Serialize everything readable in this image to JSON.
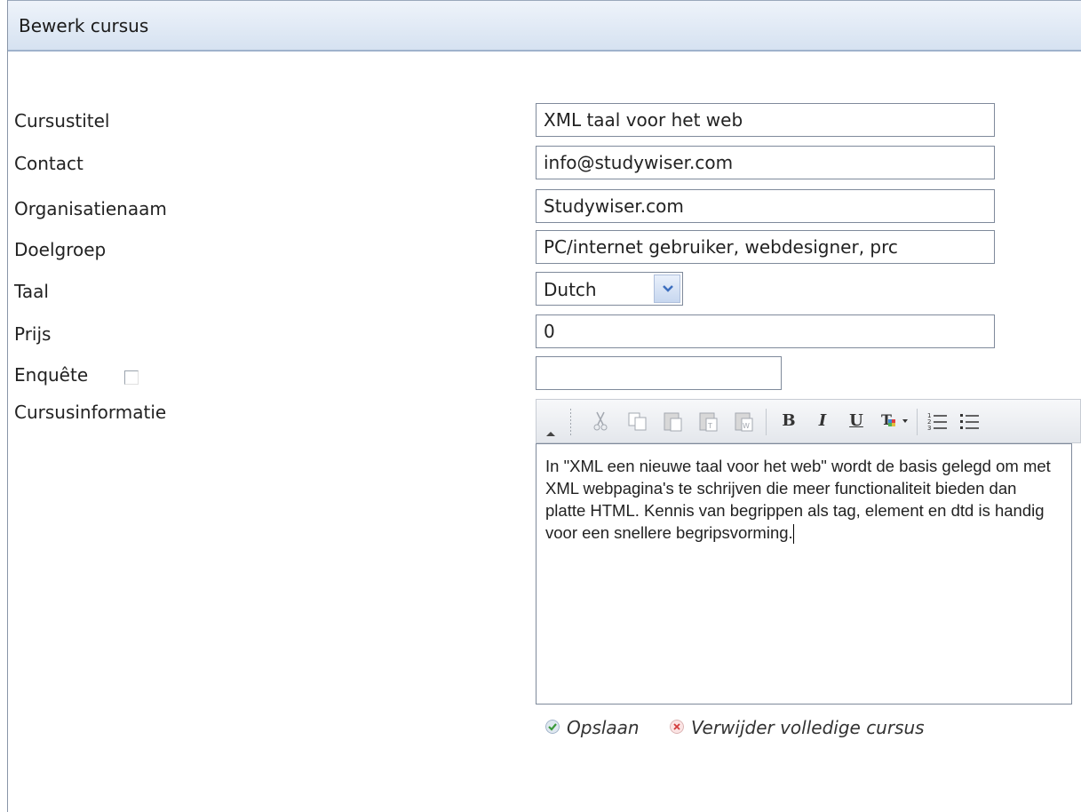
{
  "panel": {
    "title": "Bewerk cursus"
  },
  "form": {
    "course_title": {
      "label": "Cursustitel",
      "value": "XML taal voor het web"
    },
    "contact": {
      "label": "Contact",
      "value": "info@studywiser.com"
    },
    "organisation": {
      "label": "Organisatienaam",
      "value": "Studywiser.com"
    },
    "target_group": {
      "label": "Doelgroep",
      "value": "PC/internet gebruiker, webdesigner, prc"
    },
    "language": {
      "label": "Taal",
      "value": "Dutch"
    },
    "price": {
      "label": "Prijs",
      "value": "0"
    },
    "survey": {
      "label": "Enquête",
      "checked": false,
      "value": ""
    },
    "course_info": {
      "label": "Cursusinformatie",
      "text": "In \"XML een nieuwe taal voor het web\" wordt de basis gelegd om met XML webpagina's te schrijven die meer functionaliteit bieden dan platte HTML. Kennis van begrippen als tag, element en dtd is handig voor een snellere begripsvorming."
    }
  },
  "toolbar": {
    "bold": "B",
    "italic": "I",
    "underline": "U",
    "icons": [
      "cut-icon",
      "copy-icon",
      "paste-icon",
      "paste-text-icon",
      "paste-word-icon",
      "bold-icon",
      "italic-icon",
      "underline-icon",
      "text-color-icon",
      "ordered-list-icon",
      "unordered-list-icon"
    ]
  },
  "actions": {
    "save": "Opslaan",
    "delete": "Verwijder volledige cursus"
  },
  "colors": {
    "header_gradient_top": "#eef3fa",
    "header_gradient_bottom": "#d6e2f1",
    "save_icon": "#3a9a3a",
    "delete_icon": "#d23b3b"
  }
}
